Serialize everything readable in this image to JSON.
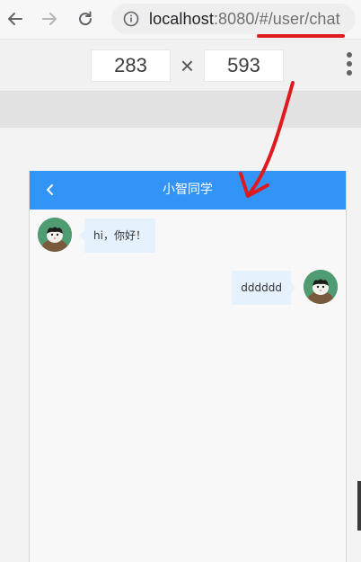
{
  "browser": {
    "url_host": "localhost",
    "url_rest": ":8080/#/user/chat",
    "icons": {
      "back": "back-arrow-icon",
      "forward": "forward-arrow-icon",
      "reload": "reload-icon",
      "info": "info-icon"
    }
  },
  "device_toolbar": {
    "width": "283",
    "height": "593",
    "separator": "×"
  },
  "app": {
    "title": "小智同学",
    "header_color": "#3294f7"
  },
  "messages": [
    {
      "side": "left",
      "text": "hi，你好！"
    },
    {
      "side": "right",
      "text": "dddddd"
    }
  ],
  "annotation_color": "#e0191e"
}
